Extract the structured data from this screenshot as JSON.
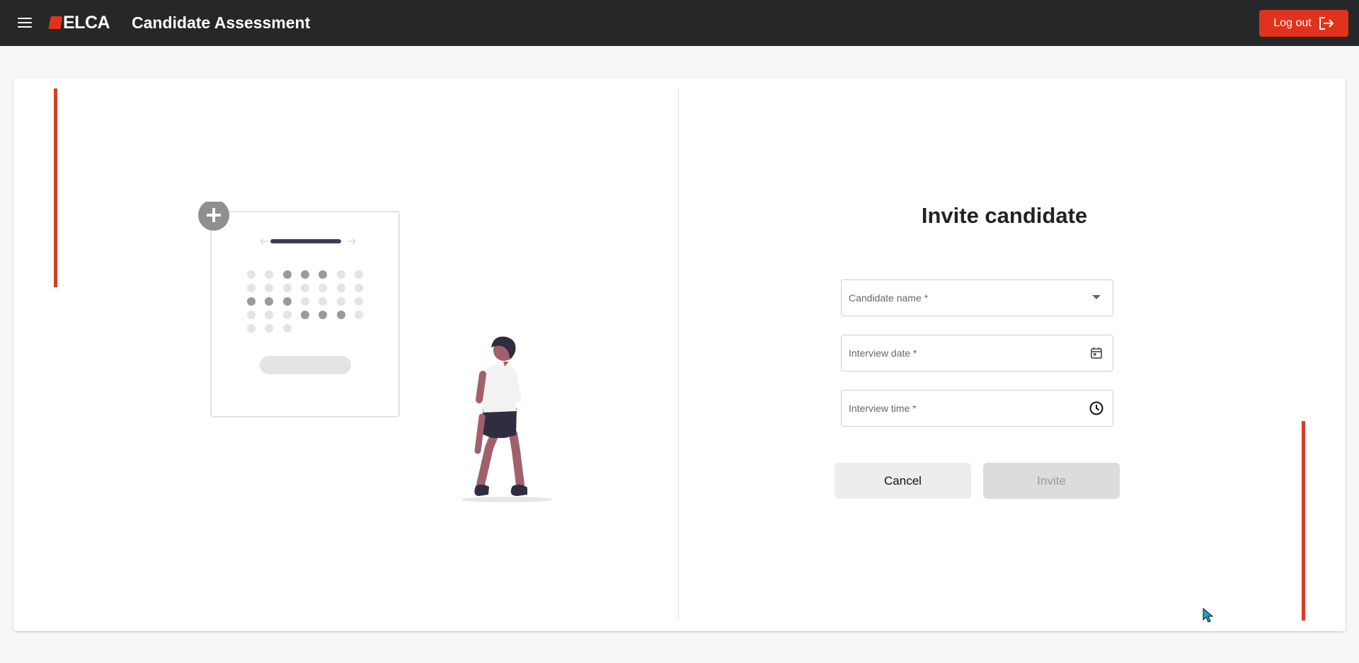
{
  "header": {
    "brand": "ELCA",
    "app_title": "Candidate Assessment",
    "logout_label": "Log out"
  },
  "form": {
    "title": "Invite candidate",
    "candidate_name_label": "Candidate name *",
    "interview_date_label": "Interview date *",
    "interview_time_label": "Interview time *",
    "cancel_label": "Cancel",
    "invite_label": "Invite"
  },
  "icons": {
    "menu": "menu-icon",
    "logout": "logout-icon",
    "dropdown": "chevron-down-icon",
    "calendar": "calendar-icon",
    "clock": "clock-icon"
  },
  "colors": {
    "accent": "#e0321c",
    "header_bg": "#262728"
  }
}
